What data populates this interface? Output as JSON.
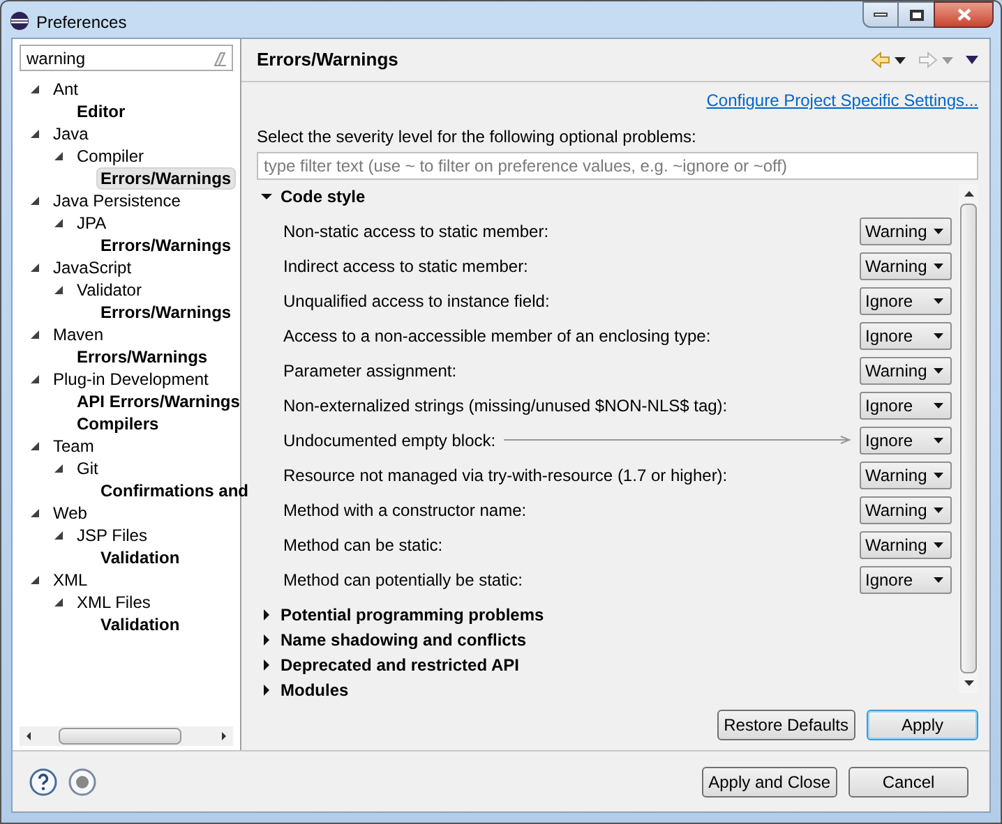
{
  "window": {
    "title": "Preferences"
  },
  "filter": {
    "value": "warning"
  },
  "tree": [
    {
      "label": "Ant",
      "expanded": true,
      "selected": false,
      "children": [
        {
          "label": "Editor",
          "selected": false
        }
      ]
    },
    {
      "label": "Java",
      "expanded": true,
      "selected": false,
      "children": [
        {
          "label": "Compiler",
          "expanded": true,
          "selected": false,
          "children": [
            {
              "label": "Errors/Warnings",
              "selected": true
            }
          ]
        }
      ]
    },
    {
      "label": "Java Persistence",
      "expanded": true,
      "selected": false,
      "children": [
        {
          "label": "JPA",
          "expanded": true,
          "selected": false,
          "children": [
            {
              "label": "Errors/Warnings",
              "selected": false
            }
          ]
        }
      ]
    },
    {
      "label": "JavaScript",
      "expanded": true,
      "selected": false,
      "children": [
        {
          "label": "Validator",
          "expanded": true,
          "selected": false,
          "children": [
            {
              "label": "Errors/Warnings",
              "selected": false
            }
          ]
        }
      ]
    },
    {
      "label": "Maven",
      "expanded": true,
      "selected": false,
      "children": [
        {
          "label": "Errors/Warnings",
          "selected": false
        }
      ]
    },
    {
      "label": "Plug-in Development",
      "expanded": true,
      "selected": false,
      "children": [
        {
          "label": "API Errors/Warnings",
          "selected": false
        },
        {
          "label": "Compilers",
          "selected": false
        }
      ]
    },
    {
      "label": "Team",
      "expanded": true,
      "selected": false,
      "children": [
        {
          "label": "Git",
          "expanded": true,
          "selected": false,
          "children": [
            {
              "label": "Confirmations and",
              "selected": false
            }
          ]
        }
      ]
    },
    {
      "label": "Web",
      "expanded": true,
      "selected": false,
      "children": [
        {
          "label": "JSP Files",
          "expanded": true,
          "selected": false,
          "children": [
            {
              "label": "Validation",
              "selected": false
            }
          ]
        }
      ]
    },
    {
      "label": "XML",
      "expanded": true,
      "selected": false,
      "children": [
        {
          "label": "XML Files",
          "expanded": true,
          "selected": false,
          "children": [
            {
              "label": "Validation",
              "selected": false
            }
          ]
        }
      ]
    }
  ],
  "page": {
    "title": "Errors/Warnings",
    "link": "Configure Project Specific Settings...",
    "instruction": "Select the severity level for the following optional problems:",
    "filter_placeholder": "type filter text (use ~ to filter on preference values, e.g. ~ignore or ~off)"
  },
  "sections": [
    {
      "label": "Code style",
      "expanded": true,
      "options": [
        {
          "label": "Non-static access to static member:",
          "value": "Warning",
          "leader_line": false
        },
        {
          "label": "Indirect access to static member:",
          "value": "Warning",
          "leader_line": false
        },
        {
          "label": "Unqualified access to instance field:",
          "value": "Ignore",
          "leader_line": false
        },
        {
          "label": "Access to a non-accessible member of an enclosing type:",
          "value": "Ignore",
          "leader_line": false
        },
        {
          "label": "Parameter assignment:",
          "value": "Warning",
          "leader_line": false
        },
        {
          "label": "Non-externalized strings (missing/unused $NON-NLS$ tag):",
          "value": "Ignore",
          "leader_line": false
        },
        {
          "label": "Undocumented empty block:",
          "value": "Ignore",
          "leader_line": true
        },
        {
          "label": "Resource not managed via try-with-resource (1.7 or higher):",
          "value": "Warning",
          "leader_line": false
        },
        {
          "label": "Method with a constructor name:",
          "value": "Warning",
          "leader_line": false
        },
        {
          "label": "Method can be static:",
          "value": "Warning",
          "leader_line": false
        },
        {
          "label": "Method can potentially be static:",
          "value": "Ignore",
          "leader_line": false
        }
      ]
    },
    {
      "label": "Potential programming problems",
      "expanded": false
    },
    {
      "label": "Name shadowing and conflicts",
      "expanded": false
    },
    {
      "label": "Deprecated and restricted API",
      "expanded": false
    },
    {
      "label": "Modules",
      "expanded": false
    }
  ],
  "page_buttons": [
    {
      "label": "Restore Defaults",
      "default": false
    },
    {
      "label": "Apply",
      "default": true
    }
  ],
  "dialog_buttons": [
    {
      "label": "Apply and Close",
      "default": false
    },
    {
      "label": "Cancel",
      "default": false
    }
  ]
}
